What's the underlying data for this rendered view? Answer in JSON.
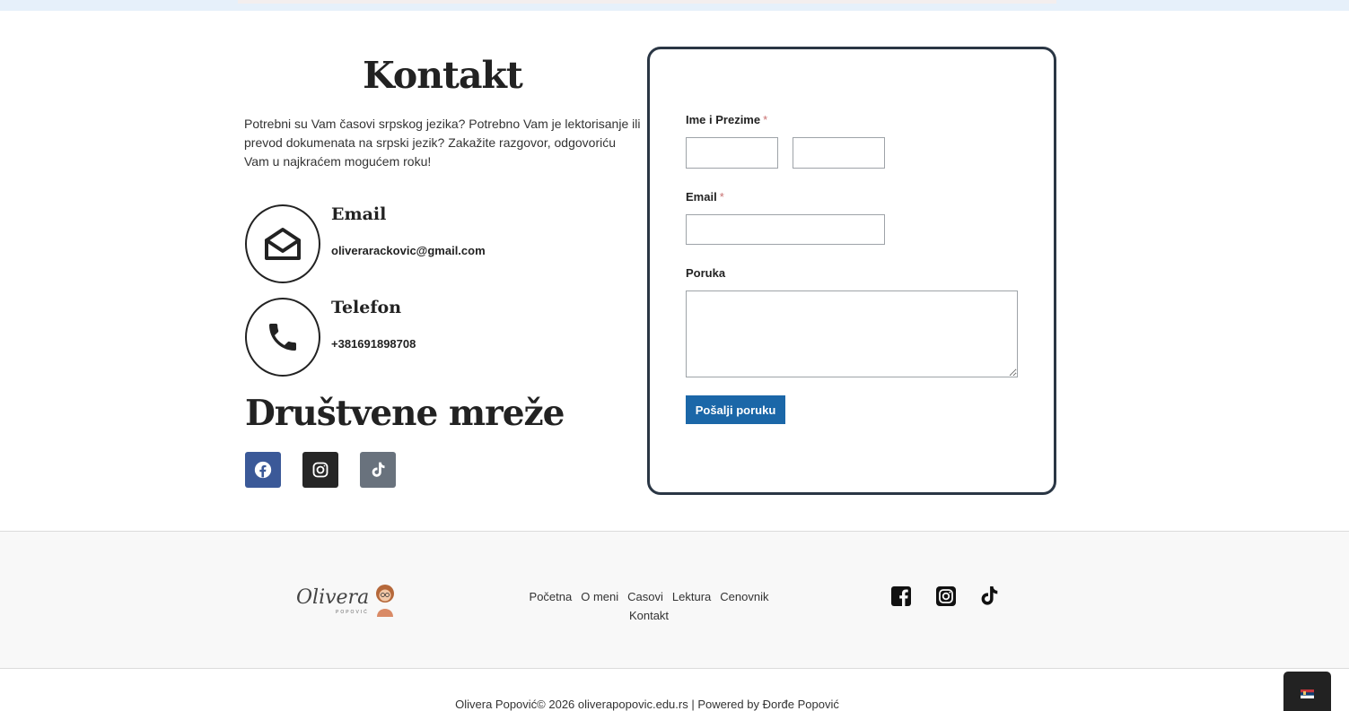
{
  "contact": {
    "heading": "Kontakt",
    "intro": "Potrebni su Vam časovi srpskog jezika? Potrebno Vam je lektorisanje ili prevod dokumenata na srpski jezik? Zakažite razgovor, odgovoriću Vam u najkraćem mogućem roku!",
    "email": {
      "title": "Email",
      "value": "oliverarackovic@gmail.com",
      "icon": "envelope-open-icon"
    },
    "phone": {
      "title": "Telefon",
      "value": "+381691898708",
      "icon": "phone-icon"
    },
    "social_heading": "Društvene mreže",
    "social": [
      {
        "name": "facebook",
        "color": "#3b5998"
      },
      {
        "name": "instagram",
        "color": "#262626"
      },
      {
        "name": "tiktok",
        "color": "#69727d"
      }
    ]
  },
  "form": {
    "name_label": "Ime i Prezime",
    "email_label": "Email",
    "message_label": "Poruka",
    "required_marker": "*",
    "submit_label": "Pošalji poruku",
    "accent": "#1b67a8",
    "border": "#2a3644"
  },
  "footer": {
    "logo_text": "Olivera",
    "logo_sub": "POPOVIĆ",
    "nav": [
      "Početna",
      "O meni",
      "Casovi",
      "Lektura",
      "Cenovnik",
      "Kontakt"
    ],
    "social_icons": [
      "facebook-icon",
      "instagram-icon",
      "tiktok-icon"
    ],
    "copyright": "Olivera Popović© 2026 oliverapopovic.edu.rs | Powered by Đorđe Popović"
  },
  "language": {
    "flag": "serbia-flag-icon"
  }
}
